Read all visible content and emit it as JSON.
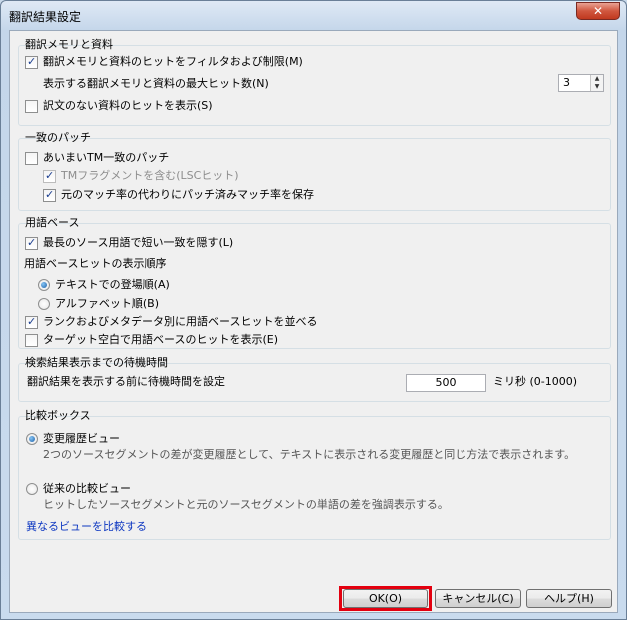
{
  "window": {
    "title": "翻訳結果設定",
    "close_label": "✕"
  },
  "tm_group": {
    "title": "翻訳メモリと資料",
    "filter_hits": {
      "label": "翻訳メモリと資料のヒットをフィルタおよび制限(M)",
      "checked": true
    },
    "max_hits_label": "表示する翻訳メモリと資料の最大ヒット数(N)",
    "max_hits_value": "3",
    "show_no_translation": {
      "label": "訳文のない資料のヒットを表示(S)",
      "checked": false
    }
  },
  "match_group": {
    "title": "一致のパッチ",
    "fuzzy": {
      "label": "あいまいTM一致のパッチ",
      "checked": false
    },
    "tm_fragment": {
      "label": "TMフラグメントを含む(LSCヒット)",
      "checked": true,
      "disabled": true
    },
    "save_patched": {
      "label": "元のマッチ率の代わりにパッチ済みマッチ率を保存",
      "checked": true
    }
  },
  "termbase_group": {
    "title": "用語ベース",
    "hide_short": {
      "label": "最長のソース用語で短い一致を隠す(L)",
      "checked": true
    },
    "order_title": "用語ベースヒットの表示順序",
    "order_text": {
      "label": "テキストでの登場順(A)",
      "checked": true
    },
    "order_alpha": {
      "label": "アルファベット順(B)",
      "checked": false
    },
    "sort_rank": {
      "label": "ランクおよびメタデータ別に用語ベースヒットを並べる",
      "checked": true
    },
    "show_empty_target": {
      "label": "ターゲット空白で用語ベースのヒットを表示(E)",
      "checked": false
    }
  },
  "wait_group": {
    "title": "検索結果表示までの待機時間",
    "label": "翻訳結果を表示する前に待機時間を設定",
    "value": "500",
    "unit": "ミリ秒 (0-1000)"
  },
  "compare_group": {
    "title": "比較ボックス",
    "change_history": {
      "label": "変更履歴ビュー",
      "desc": "2つのソースセグメントの差が変更履歴として、テキストに表示される変更履歴と同じ方法で表示されます。",
      "checked": true
    },
    "classic": {
      "label": "従来の比較ビュー",
      "desc": "ヒットしたソースセグメントと元のソースセグメントの単語の差を強調表示する。",
      "checked": false
    },
    "link": "異なるビューを比較する"
  },
  "buttons": {
    "ok": "OK(O)",
    "cancel": "キャンセル(C)",
    "help": "ヘルプ(H)"
  },
  "colors": {
    "highlight": "#e3000f",
    "link": "#0d37c1"
  }
}
